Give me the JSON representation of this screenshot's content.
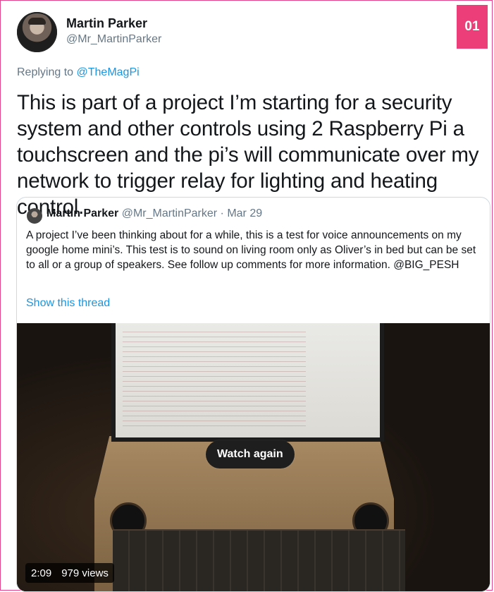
{
  "badge": "01",
  "tweet": {
    "author_name": "Martin Parker",
    "author_handle": "@Mr_MartinParker",
    "replying_prefix": "Replying to ",
    "replying_to": "@TheMagPi",
    "text": "This is part of a project I’m starting for a security system and other controls using 2 Raspberry Pi a touchscreen and the pi’s will communicate over my network to trigger relay for lighting and heating control."
  },
  "quoted": {
    "author_name": "Martin Parker",
    "author_handle": "@Mr_MartinParker",
    "date": "· Mar 29",
    "text": "A project I’ve been thinking about for a while, this is a test for voice announcements on my google home mini’s. This test is to sound on living room only as Oliver’s in bed but can be set to all or a group of speakers. See follow up comments for more information. @BIG_PESH",
    "show_thread": "Show this thread",
    "video": {
      "watch_again": "Watch again",
      "duration": "2:09",
      "views": "979 views"
    }
  }
}
